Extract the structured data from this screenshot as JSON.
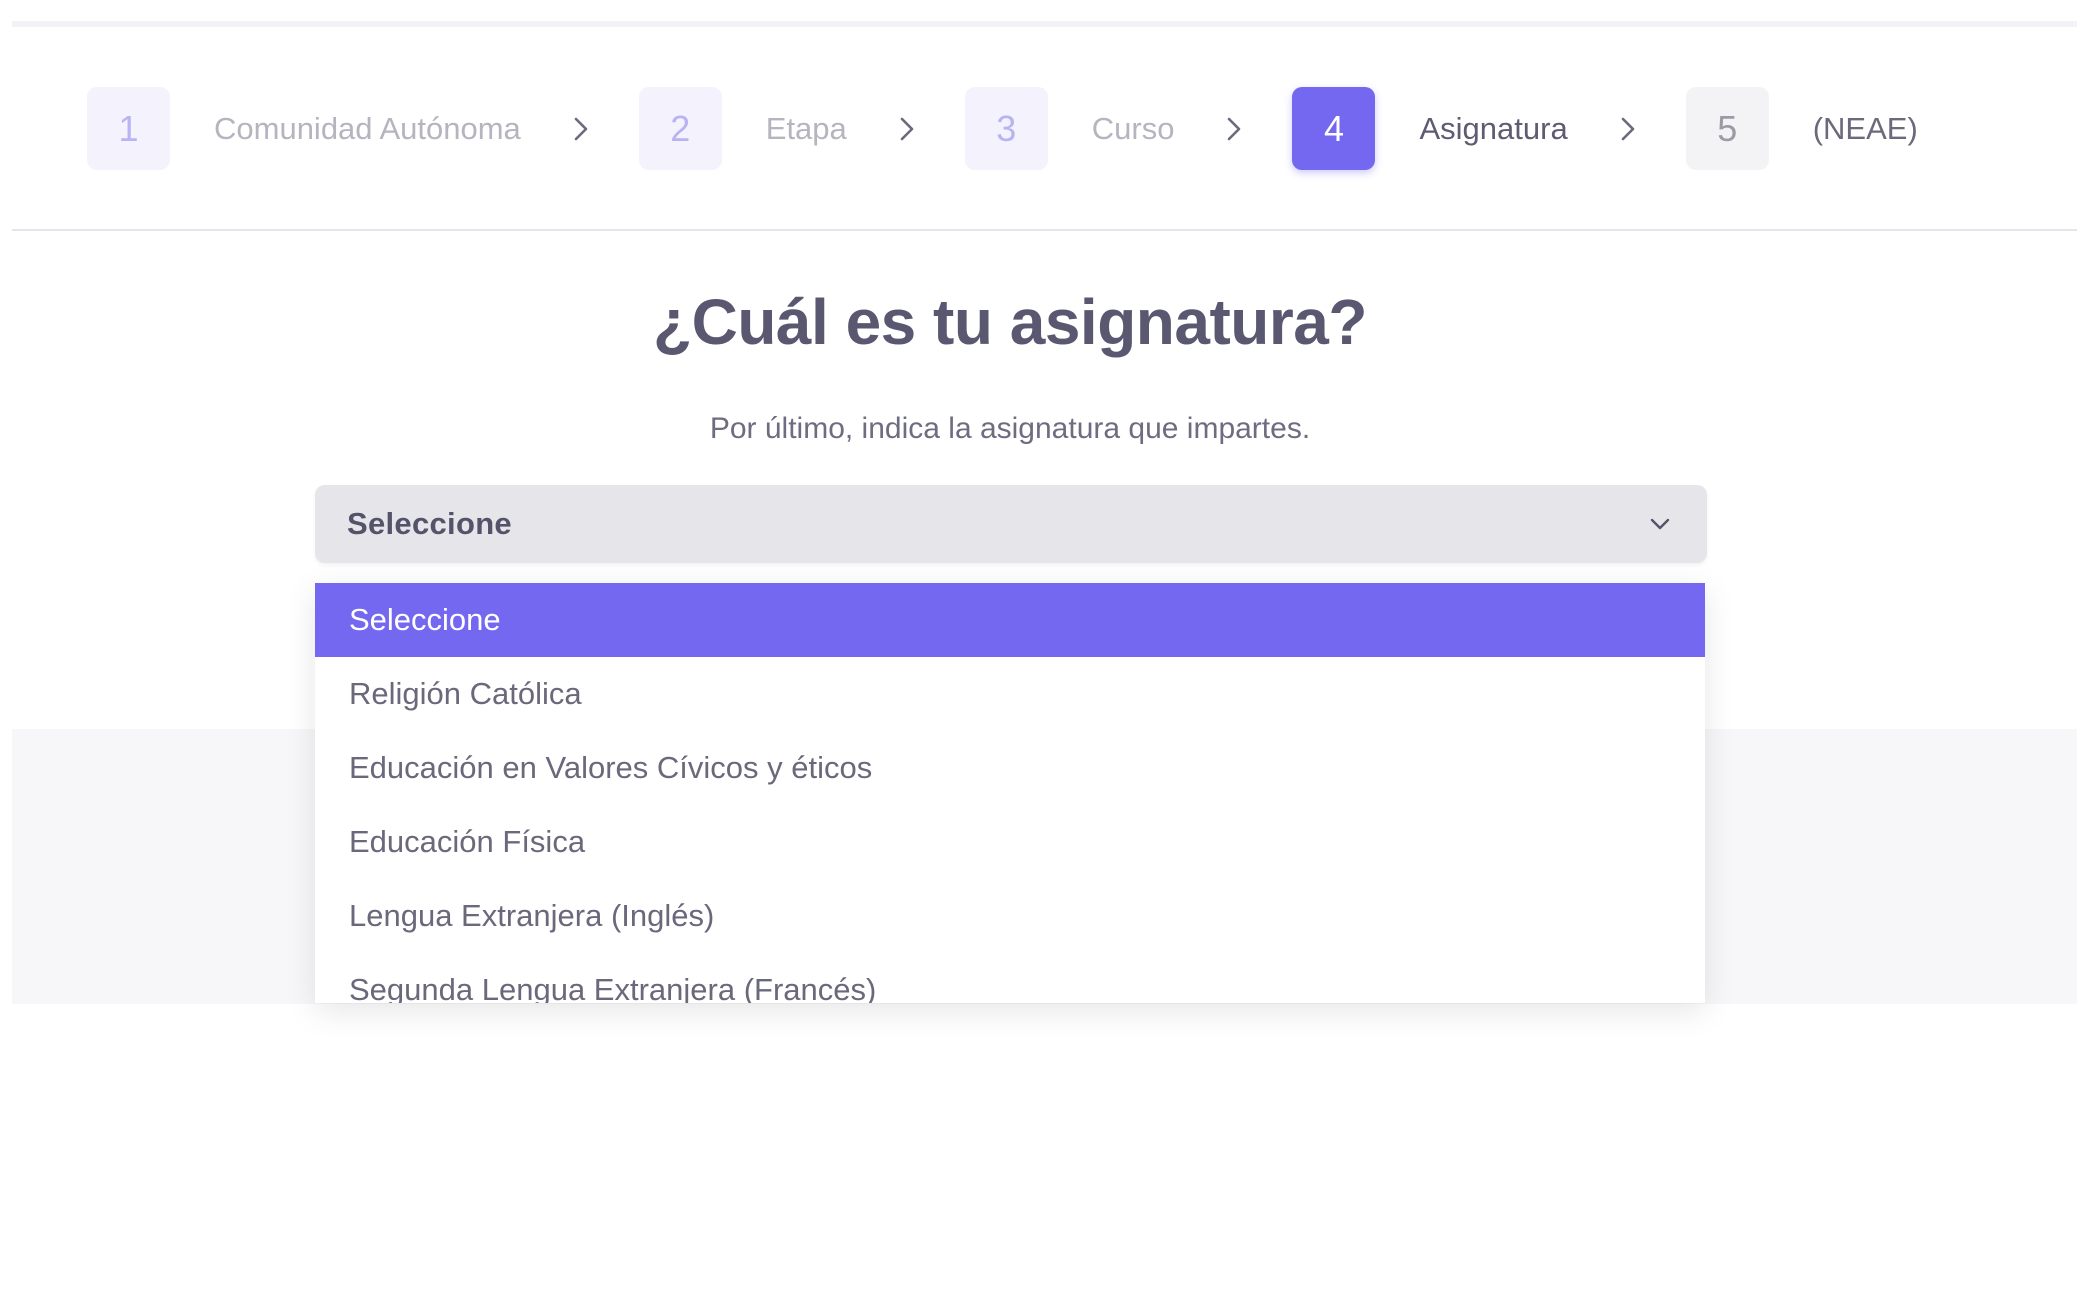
{
  "stepper": {
    "steps": [
      {
        "number": "1",
        "label": "Comunidad Autónoma",
        "state": "done"
      },
      {
        "number": "2",
        "label": "Etapa",
        "state": "done"
      },
      {
        "number": "3",
        "label": "Curso",
        "state": "done"
      },
      {
        "number": "4",
        "label": "Asignatura",
        "state": "active"
      },
      {
        "number": "5",
        "label": "(NEAE)",
        "state": "pending"
      }
    ],
    "separator_icon": "chevron-right-icon"
  },
  "main": {
    "title": "¿Cuál es tu asignatura?",
    "subtitle": "Por último, indica la asignatura que impartes."
  },
  "subject_select": {
    "value": "Seleccione",
    "icon": "chevron-down-icon",
    "options": [
      "Seleccione",
      "Religión Católica",
      "Educación en Valores Cívicos y éticos",
      "Educación Física",
      "Lengua Extranjera (Inglés)",
      "Segunda Lengua Extranjera (Francés)"
    ],
    "highlighted_index": 0
  },
  "colors": {
    "accent": "#7467f0",
    "text": "#5a5870",
    "muted": "#b5b5c0",
    "select_bg": "#e5e5ea"
  }
}
